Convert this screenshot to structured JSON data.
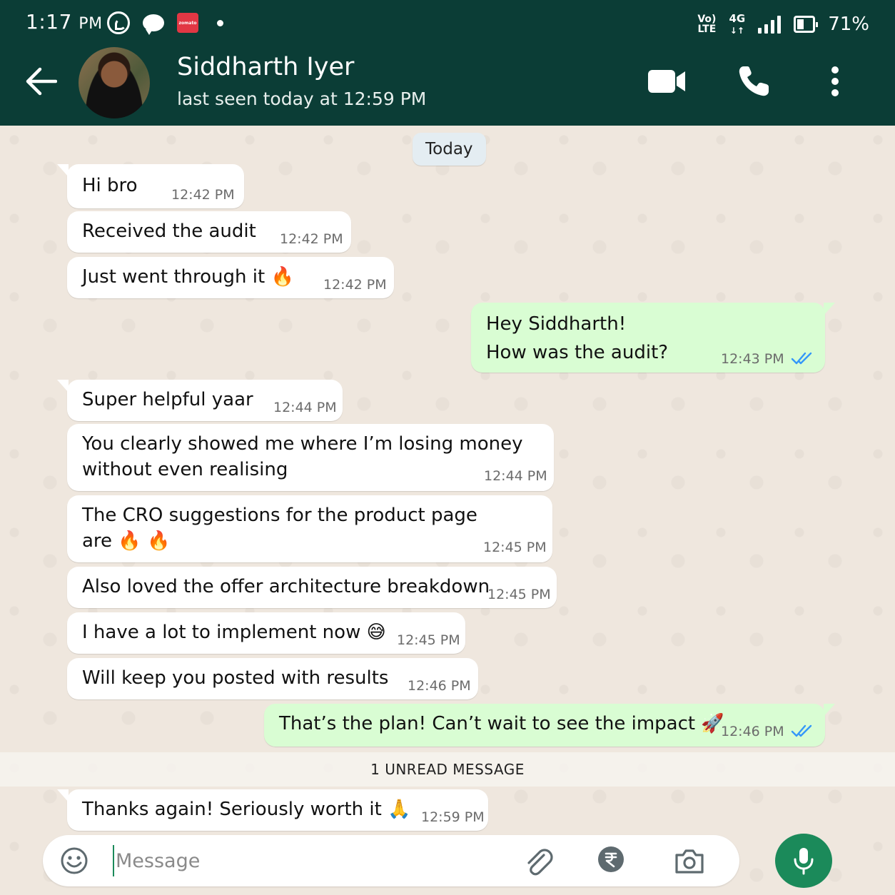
{
  "status_bar": {
    "time": "1:17",
    "time_suffix": "PM",
    "volte": "Vo)\nLTE",
    "network": "4G",
    "battery": "71%"
  },
  "header": {
    "contact_name": "Siddharth Iyer",
    "last_seen": "last seen today at 12:59 PM"
  },
  "chat": {
    "date_chip": "Today",
    "messages": [
      {
        "dir": "in",
        "text": "Hi bro",
        "time": "12:42 PM"
      },
      {
        "dir": "in",
        "text": "Received the audit",
        "time": "12:42 PM"
      },
      {
        "dir": "in",
        "text": "Just went through it 🔥",
        "time": "12:42 PM"
      },
      {
        "dir": "out",
        "text": "Hey Siddharth!\nHow was the audit?",
        "time": "12:43 PM",
        "read": true
      },
      {
        "dir": "in",
        "text": "Super helpful yaar",
        "time": "12:44 PM"
      },
      {
        "dir": "in",
        "text": "You clearly showed me where I’m losing money\nwithout even realising",
        "time": "12:44 PM"
      },
      {
        "dir": "in",
        "text": "The CRO suggestions for the product page\nare 🔥 🔥",
        "time": "12:45 PM"
      },
      {
        "dir": "in",
        "text": "Also loved the offer architecture breakdown",
        "time": "12:45 PM"
      },
      {
        "dir": "in",
        "text": "I have a lot to implement now 😅",
        "time": "12:45 PM"
      },
      {
        "dir": "in",
        "text": "Will keep you posted with results",
        "time": "12:46 PM"
      },
      {
        "dir": "out",
        "text": "That’s the plan! Can’t wait to see the impact 🚀",
        "time": "12:46 PM",
        "read": true
      },
      {
        "dir": "in",
        "text": "Thanks again! Seriously worth it 🙏",
        "time": "12:59 PM"
      }
    ],
    "unread_label": "1 UNREAD MESSAGE"
  },
  "input": {
    "placeholder": "Message"
  },
  "colors": {
    "header_bg": "#0b3d36",
    "outgoing_bubble": "#d9fdd3",
    "incoming_bubble": "#ffffff",
    "read_ticks": "#3497f9",
    "mic_button": "#1b8a5a"
  },
  "icons": [
    "whatsapp-status-icon",
    "message-status-icon",
    "zomato-status-icon",
    "signal-icon",
    "battery-icon",
    "back-arrow-icon",
    "video-call-icon",
    "phone-icon",
    "more-vert-icon",
    "emoji-icon",
    "attach-icon",
    "rupee-icon",
    "camera-icon",
    "mic-icon",
    "double-check-icon"
  ]
}
